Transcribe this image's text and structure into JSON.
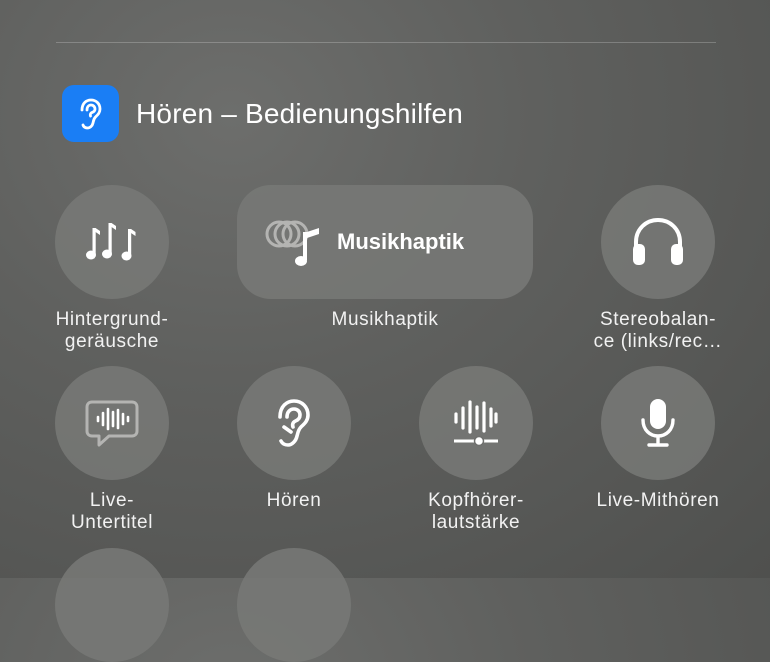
{
  "header": {
    "title": "Hören – Bedienungshilfen",
    "icon": "ear-icon"
  },
  "controls": [
    {
      "name": "Hintergrundgeräusche",
      "label_lines": [
        "Hintergrund-",
        "geräusche"
      ],
      "icon": "music-notes-icon"
    },
    {
      "name": "Musikhaptik",
      "pill_label": "Musikhaptik",
      "label_lines": [
        "Musikhaptik"
      ],
      "icon": "music-haptics-icon"
    },
    {
      "name": "Stereobalance",
      "label_lines": [
        "Stereobalan-",
        "ce (links/rec…"
      ],
      "icon": "headphones-icon"
    },
    {
      "name": "Live-Untertitel",
      "label_lines": [
        "Live-",
        "Untertitel"
      ],
      "icon": "live-captions-icon"
    },
    {
      "name": "Hören",
      "label_lines": [
        "Hören"
      ],
      "icon": "ear-icon"
    },
    {
      "name": "Kopfhörerlautstärke",
      "label_lines": [
        "Kopfhörer-",
        "lautstärke"
      ],
      "icon": "headphone-level-icon"
    },
    {
      "name": "Live-Mithören",
      "label_lines": [
        "Live-Mithören"
      ],
      "icon": "microphone-icon"
    }
  ],
  "colors": {
    "accent": "#1a7ef5",
    "tile": "#787977"
  }
}
